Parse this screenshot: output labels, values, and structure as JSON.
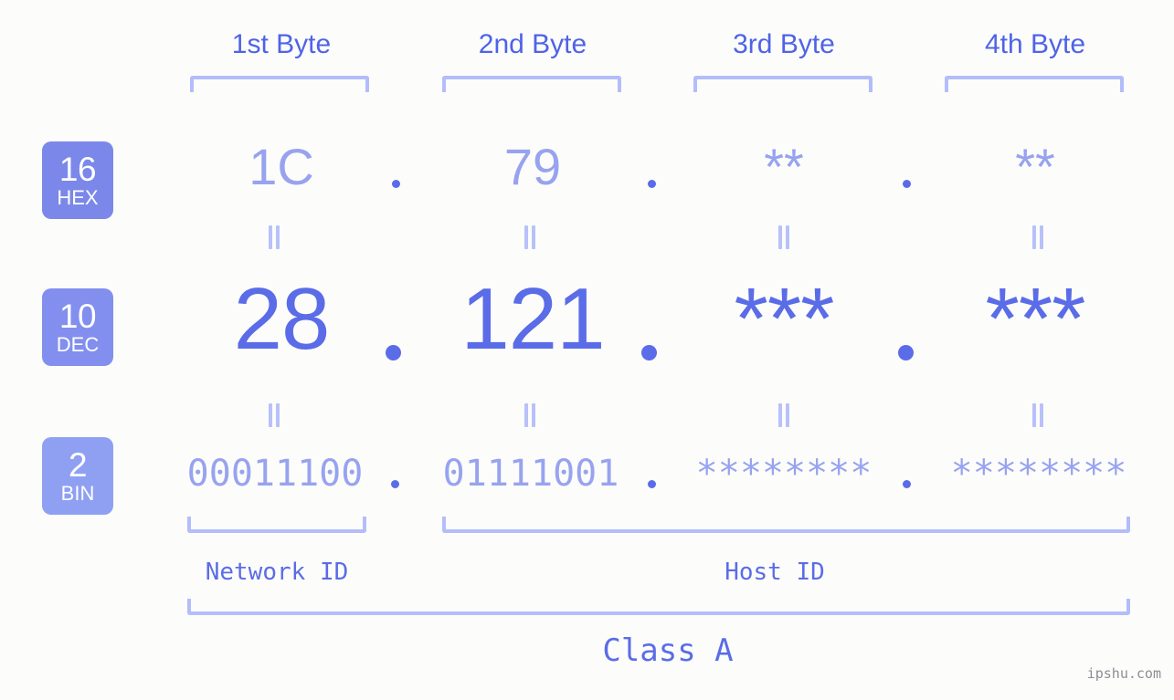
{
  "background_color": "#fcfdfa",
  "accent_color": "#5b6ce8",
  "muted_accent_color": "#98a3ef",
  "bracket_color": "#b3bdfb",
  "headers": {
    "byte1": "1st Byte",
    "byte2": "2nd Byte",
    "byte3": "3rd Byte",
    "byte4": "4th Byte"
  },
  "bases": [
    {
      "number": "16",
      "label": "HEX",
      "color": "#7b88e9"
    },
    {
      "number": "10",
      "label": "DEC",
      "color": "#828fee"
    },
    {
      "number": "2",
      "label": "BIN",
      "color": "#8fa0f3"
    }
  ],
  "rows": {
    "hex": {
      "base_number": "16",
      "base_label": "HEX",
      "values": [
        "1C",
        "79",
        "**",
        "**"
      ],
      "separator": "."
    },
    "dec": {
      "base_number": "10",
      "base_label": "DEC",
      "values": [
        "28",
        "121",
        "***",
        "***"
      ],
      "separator": "."
    },
    "bin": {
      "base_number": "2",
      "base_label": "BIN",
      "values": [
        "00011100",
        "01111001",
        "********",
        "********"
      ],
      "separator": "."
    }
  },
  "equals_symbol": "=",
  "sections": {
    "network_id": "Network ID",
    "host_id": "Host ID",
    "class": "Class A"
  },
  "watermark": "ipshu.com"
}
